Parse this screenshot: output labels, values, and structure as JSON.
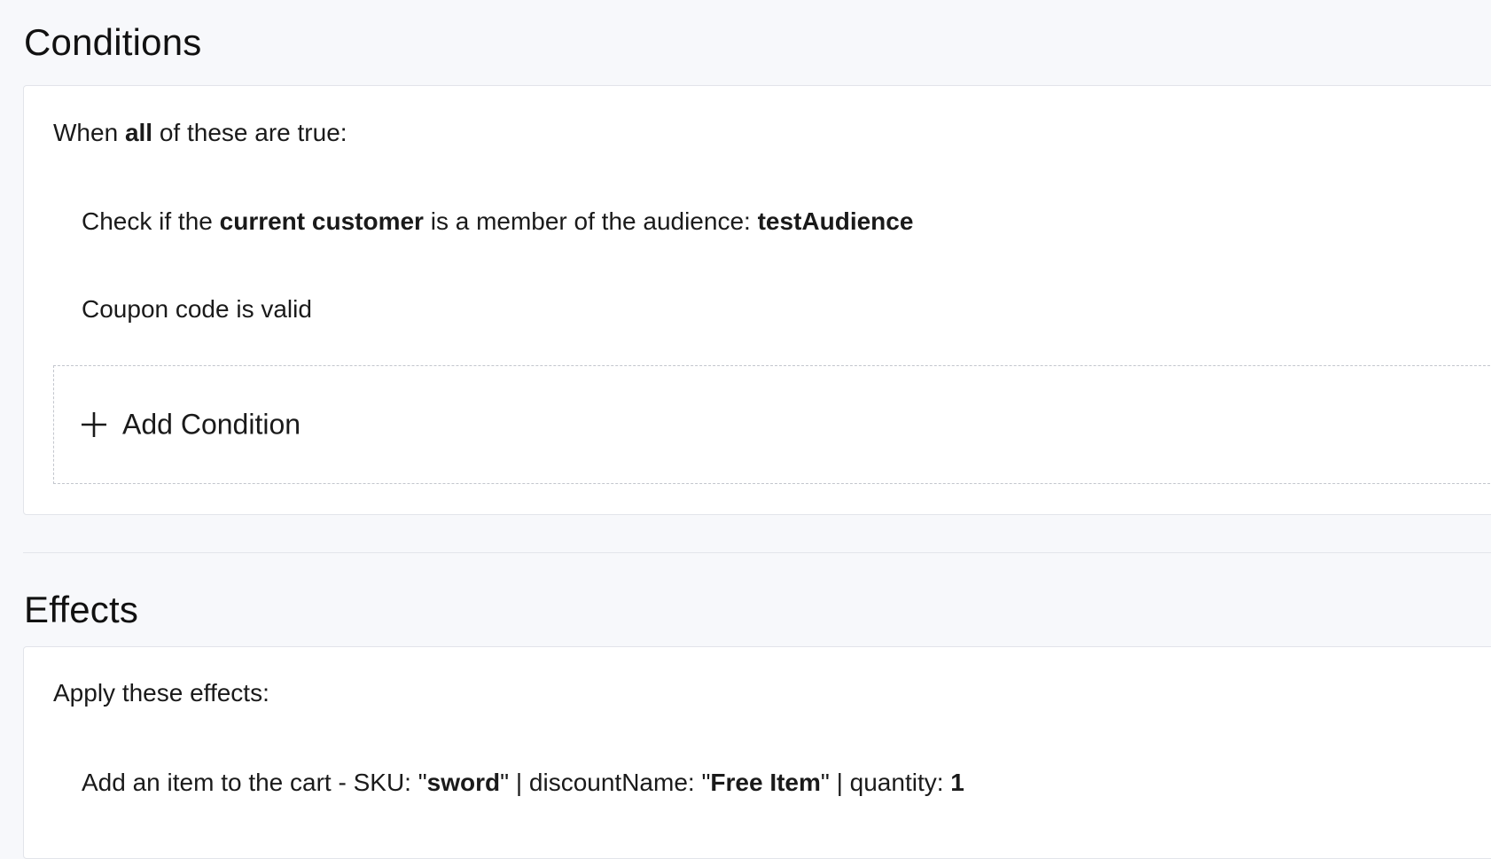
{
  "conditions": {
    "title": "Conditions",
    "heading_prefix": "When ",
    "heading_bold": "all",
    "heading_suffix": " of these are true:",
    "rules": [
      {
        "prefix": "Check if the ",
        "bold_1": "current customer",
        "middle": " is a member of the audience: ",
        "bold_2": "testAudience"
      },
      {
        "text": "Coupon code is valid"
      }
    ],
    "add_label": "Add Condition",
    "add_icon": "plus-icon"
  },
  "effects": {
    "title": "Effects",
    "heading": "Apply these effects:",
    "rules": [
      {
        "prefix": "Add an item to the cart - SKU: \"",
        "sku": "sword",
        "mid": "\" | discountName: \"",
        "discount_name": "Free Item",
        "suffix": "\" | quantity: ",
        "quantity": "1"
      }
    ]
  }
}
